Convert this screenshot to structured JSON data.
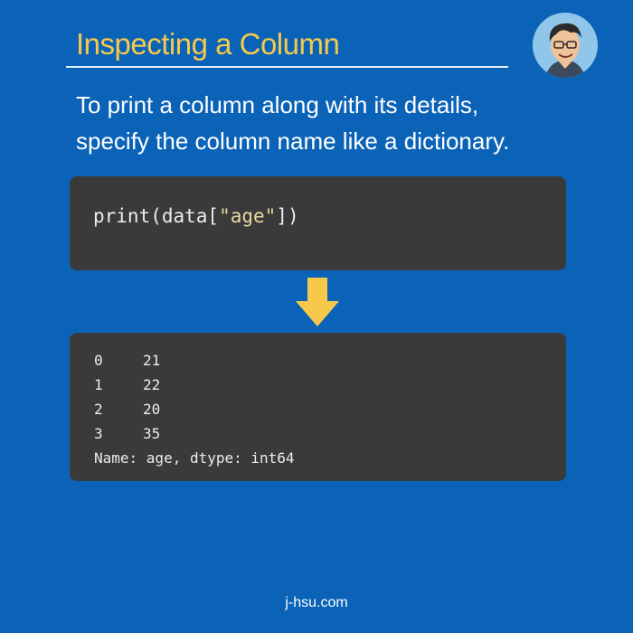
{
  "header": {
    "title": "Inspecting a Column"
  },
  "intro": {
    "line1": "To print a column along with its details,",
    "line2": "specify the column name like a dictionary."
  },
  "code": {
    "prefix": "print(data[",
    "string": "\"age\"",
    "suffix": "])"
  },
  "output": {
    "rows": [
      {
        "index": "0",
        "value": "21"
      },
      {
        "index": "1",
        "value": "22"
      },
      {
        "index": "2",
        "value": "20"
      },
      {
        "index": "3",
        "value": "35"
      }
    ],
    "summary": "Name: age, dtype: int64"
  },
  "footer": {
    "site": "j-hsu.com"
  },
  "colors": {
    "background": "#0b63b8",
    "title": "#f6c94a",
    "code_box": "#3a3a3a",
    "arrow": "#f6c94a"
  },
  "icons": {
    "avatar": "cartoon-avatar-portrait",
    "arrow": "down-arrow-icon"
  }
}
